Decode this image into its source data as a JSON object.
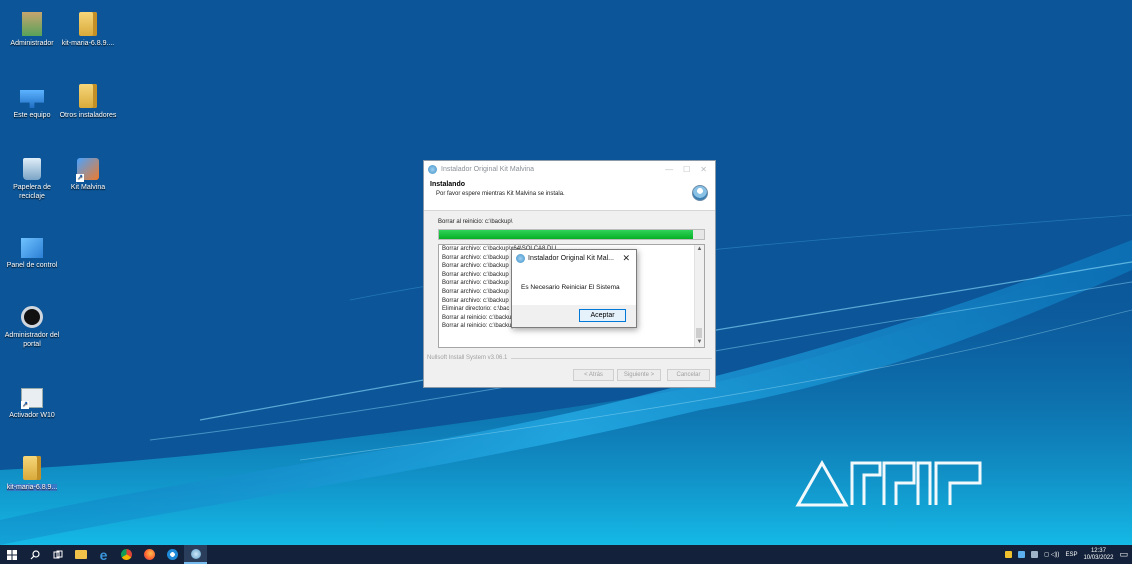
{
  "desktop": {
    "icons": [
      {
        "id": "administrador",
        "label": "Administrador",
        "icon": "user-folder-icon"
      },
      {
        "id": "kit-maria",
        "label": "kit-maria-6.8.9....",
        "icon": "folder-icon"
      },
      {
        "id": "este-equipo",
        "label": "Este equipo",
        "icon": "computer-icon"
      },
      {
        "id": "otros-instaladores",
        "label": "Otros instaladores",
        "icon": "folder-icon"
      },
      {
        "id": "papelera",
        "label": "Papelera de reciclaje",
        "icon": "recycle-bin-icon"
      },
      {
        "id": "kit-malvina",
        "label": "Kit Malvina",
        "icon": "kit-malvina-icon"
      },
      {
        "id": "panel-control",
        "label": "Panel de control",
        "icon": "control-panel-icon"
      },
      {
        "id": "admin-portal",
        "label": "Administrador del portal",
        "icon": "portal-icon"
      },
      {
        "id": "activador",
        "label": "Activador W10",
        "icon": "activator-icon"
      },
      {
        "id": "kit-maria-2",
        "label": "kit-maria-6.8.9...",
        "icon": "zip-folder-icon"
      }
    ],
    "wallpaper_logo": "AFIP"
  },
  "installer": {
    "title": "Instalador Original Kit Malvina",
    "header_title": "Instalando",
    "header_subtitle": "Por favor espere mientras Kit Malvina se instala.",
    "status": "Borrar al reinicio: c:\\backup\\",
    "progress_fraction": 0.96,
    "log": [
      "Borrar archivo: c:\\backup\\x64\\SQLCA8.DLL",
      "Borrar archivo: c:\\backup",
      "Borrar archivo: c:\\backup",
      "Borrar archivo: c:\\backup",
      "Borrar archivo: c:\\backup",
      "Borrar archivo: c:\\backup",
      "Borrar archivo: c:\\backup",
      "Eliminar directorio: c:\\bac",
      "Borrar al reinicio: c:\\backup\\Fase2.exe",
      "Borrar al reinicio: c:\\backup\\"
    ],
    "branding": "Nullsoft Install System v3.06.1",
    "buttons": {
      "back": "< Atrás",
      "next": "Siguiente >",
      "cancel": "Cancelar"
    }
  },
  "msgbox": {
    "title": "Instalador Original Kit Mal...",
    "close": "✕",
    "message": "Es Necesario Reiniciar El Sistema",
    "ok": "Aceptar"
  },
  "taskbar": {
    "items": [
      "windows-start-icon",
      "search-icon",
      "task-view-icon",
      "file-explorer-icon",
      "edge-icon",
      "chrome-icon",
      "firefox-icon",
      "app-icon",
      "installer-icon"
    ],
    "tray_lang": "ESP",
    "time": "12:37",
    "date": "10/03/2022"
  },
  "colors": {
    "progress": "#06b025",
    "taskbar": "#13223a",
    "accent": "#0078d7"
  }
}
